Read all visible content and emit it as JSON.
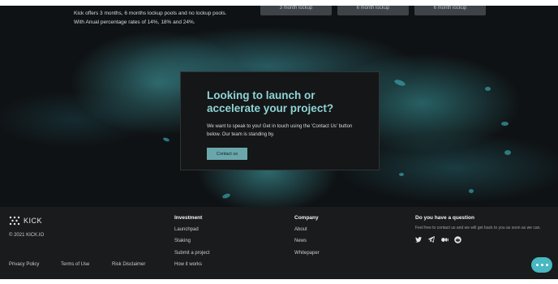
{
  "intro": {
    "line1": "Kick offers 3 months, 6 months lockup pools and no lockup pools.",
    "line2": "With Anual percentage rates of 14%, 18% and 24%."
  },
  "lockup_tabs": [
    "3 month lockup",
    "6 month lockup",
    "6 month lockup"
  ],
  "contact": {
    "title": "Looking to launch or accelerate your project?",
    "text": "We want to speak to you! Get in touch using the 'Contact Us' button below. Our team is standing by.",
    "button": "Contact us"
  },
  "footer": {
    "logo": "KICK",
    "copyright": "© 2021 KICK.IO",
    "investment": {
      "heading": "Investment",
      "links": [
        "Launchpad",
        "Staking",
        "Submit a project",
        "How it works"
      ]
    },
    "company": {
      "heading": "Company",
      "links": [
        "About",
        "News",
        "Whitepaper"
      ]
    },
    "question": {
      "heading": "Do you have a question",
      "text": "Feel free to contact us and we will get back to you as soon as we can."
    },
    "legal": [
      "Privacy Policy",
      "Terms of Use",
      "Risk Disclaimer"
    ],
    "social_icons": [
      "twitter-icon",
      "telegram-icon",
      "medium-icon",
      "reddit-icon"
    ]
  },
  "colors": {
    "accent": "#8fd4d6",
    "button": "#6aa7ad",
    "chat": "#48b8c2",
    "background": "#17191a"
  }
}
